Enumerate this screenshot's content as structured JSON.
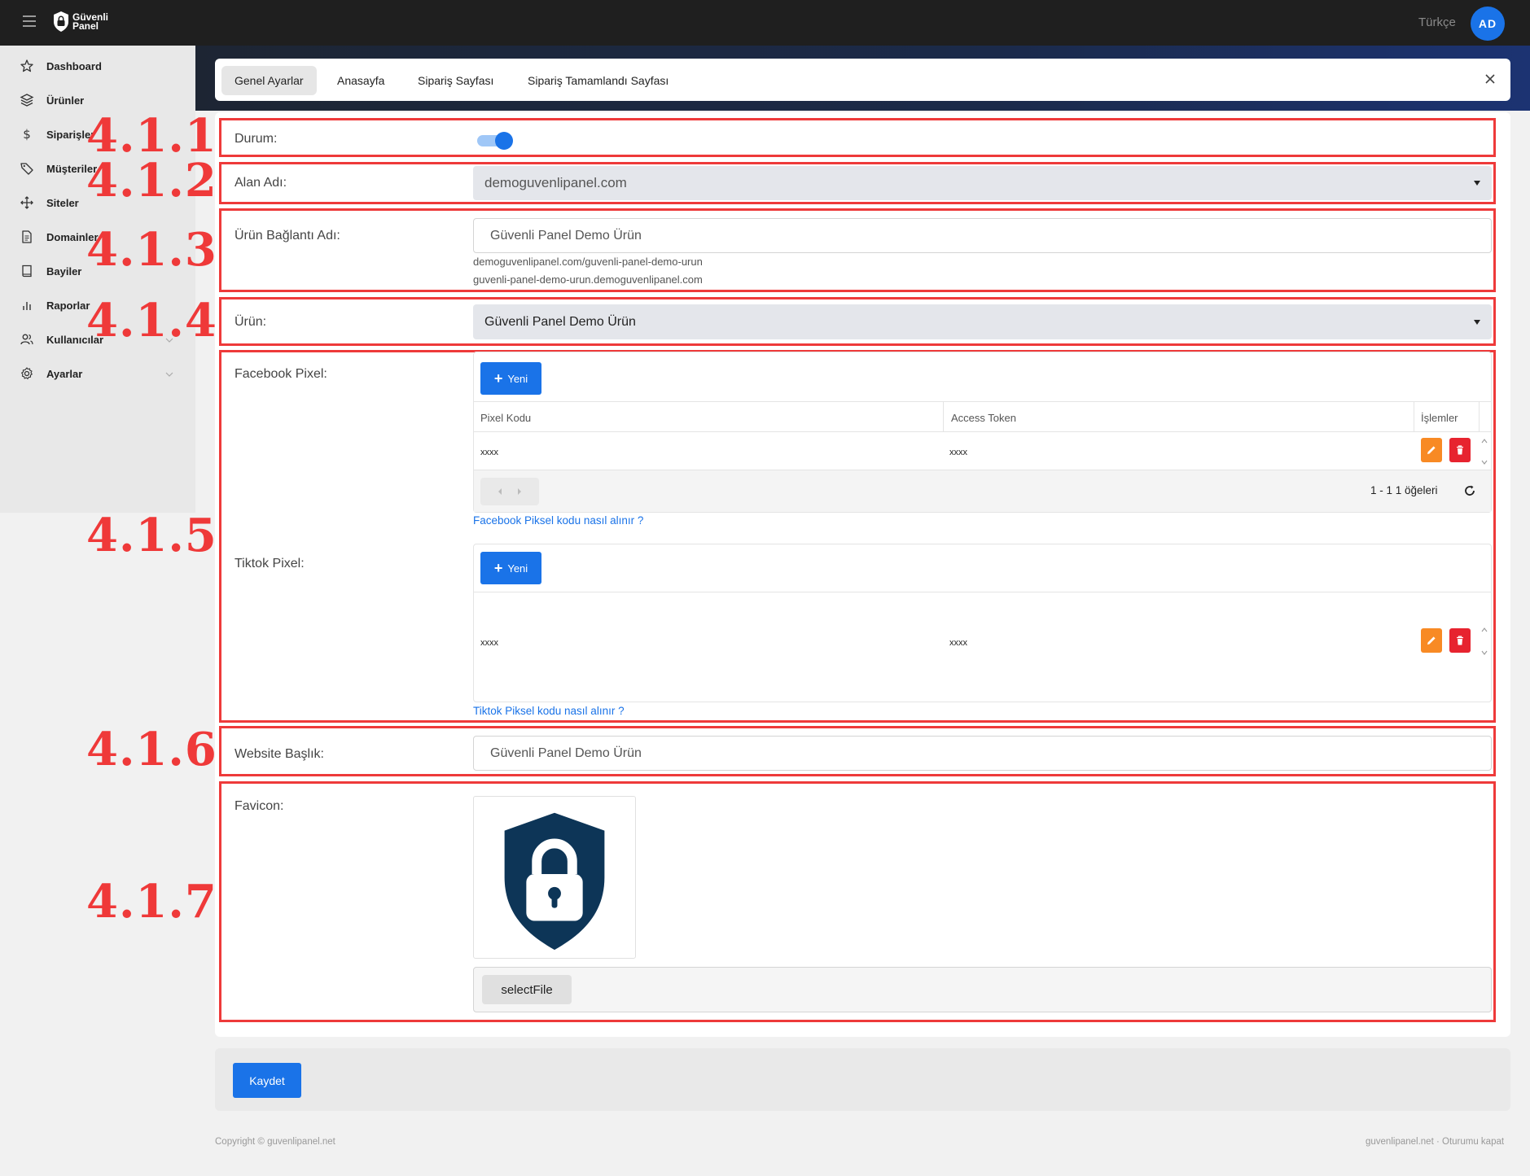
{
  "brand": {
    "line1": "Güvenli",
    "line2": "Panel"
  },
  "topbar": {
    "language": "Türkçe",
    "avatar_initials": "AD"
  },
  "sidebar": {
    "items": [
      {
        "label": "Dashboard",
        "icon": "star-icon"
      },
      {
        "label": "Ürünler",
        "icon": "layers-icon"
      },
      {
        "label": "Siparişler",
        "icon": "dollar-icon"
      },
      {
        "label": "Müşteriler",
        "icon": "tag-icon"
      },
      {
        "label": "Siteler",
        "icon": "move-icon"
      },
      {
        "label": "Domainler",
        "icon": "document-icon"
      },
      {
        "label": "Bayiler",
        "icon": "book-icon"
      },
      {
        "label": "Raporlar",
        "icon": "bar-chart-icon"
      },
      {
        "label": "Kullanıcılar",
        "icon": "users-icon"
      },
      {
        "label": "Ayarlar",
        "icon": "gear-icon"
      }
    ]
  },
  "tabs": [
    "Genel Ayarlar",
    "Anasayfa",
    "Sipariş Sayfası",
    "Sipariş Tamamlandı Sayfası"
  ],
  "section_numbers": [
    "4.1.1",
    "4.1.2",
    "4.1.3",
    "4.1.4",
    "4.1.5",
    "4.1.6",
    "4.1.7"
  ],
  "form": {
    "status": {
      "label": "Durum:",
      "enabled": true
    },
    "domain": {
      "label": "Alan Adı:",
      "value": "demoguvenlipanel.com"
    },
    "product_link": {
      "label": "Ürün Bağlantı Adı:",
      "value": "Güvenli Panel Demo Ürün",
      "hint1": "demoguvenlipanel.com/guvenli-panel-demo-urun",
      "hint2": "guvenli-panel-demo-urun.demoguvenlipanel.com"
    },
    "product": {
      "label": "Ürün:",
      "value": "Güvenli Panel Demo Ürün"
    },
    "facebook": {
      "label": "Facebook Pixel:",
      "new_button": "Yeni",
      "columns": [
        "Pixel Kodu",
        "Access Token",
        "İşlemler"
      ],
      "rows": [
        {
          "pixel_code": "xxxx",
          "access_token": "xxxx"
        }
      ],
      "pager_info": "1 - 1 1 öğeleri",
      "help_link": "Facebook Piksel kodu nasıl alınır ?"
    },
    "tiktok": {
      "label": "Tiktok Pixel:",
      "new_button": "Yeni",
      "rows": [
        {
          "pixel_code": "xxxx",
          "access_token": "xxxx"
        }
      ],
      "help_link": "Tiktok Piksel kodu nasıl alınır ?"
    },
    "website_title": {
      "label": "Website Başlık:",
      "value": "Güvenli Panel Demo Ürün"
    },
    "favicon": {
      "label": "Favicon:",
      "select_button": "selectFile"
    }
  },
  "actions": {
    "save": "Kaydet"
  },
  "footer": {
    "copyright": "Copyright © guvenlipanel.net",
    "site_link": "guvenlipanel.net",
    "separator": " · ",
    "logout": "Oturumu kapat"
  },
  "colors": {
    "primary": "#1a73e8",
    "highlight_border": "#ee3a3a",
    "edit": "#f88a24",
    "delete": "#e7232f",
    "shield": "#0d3557"
  }
}
